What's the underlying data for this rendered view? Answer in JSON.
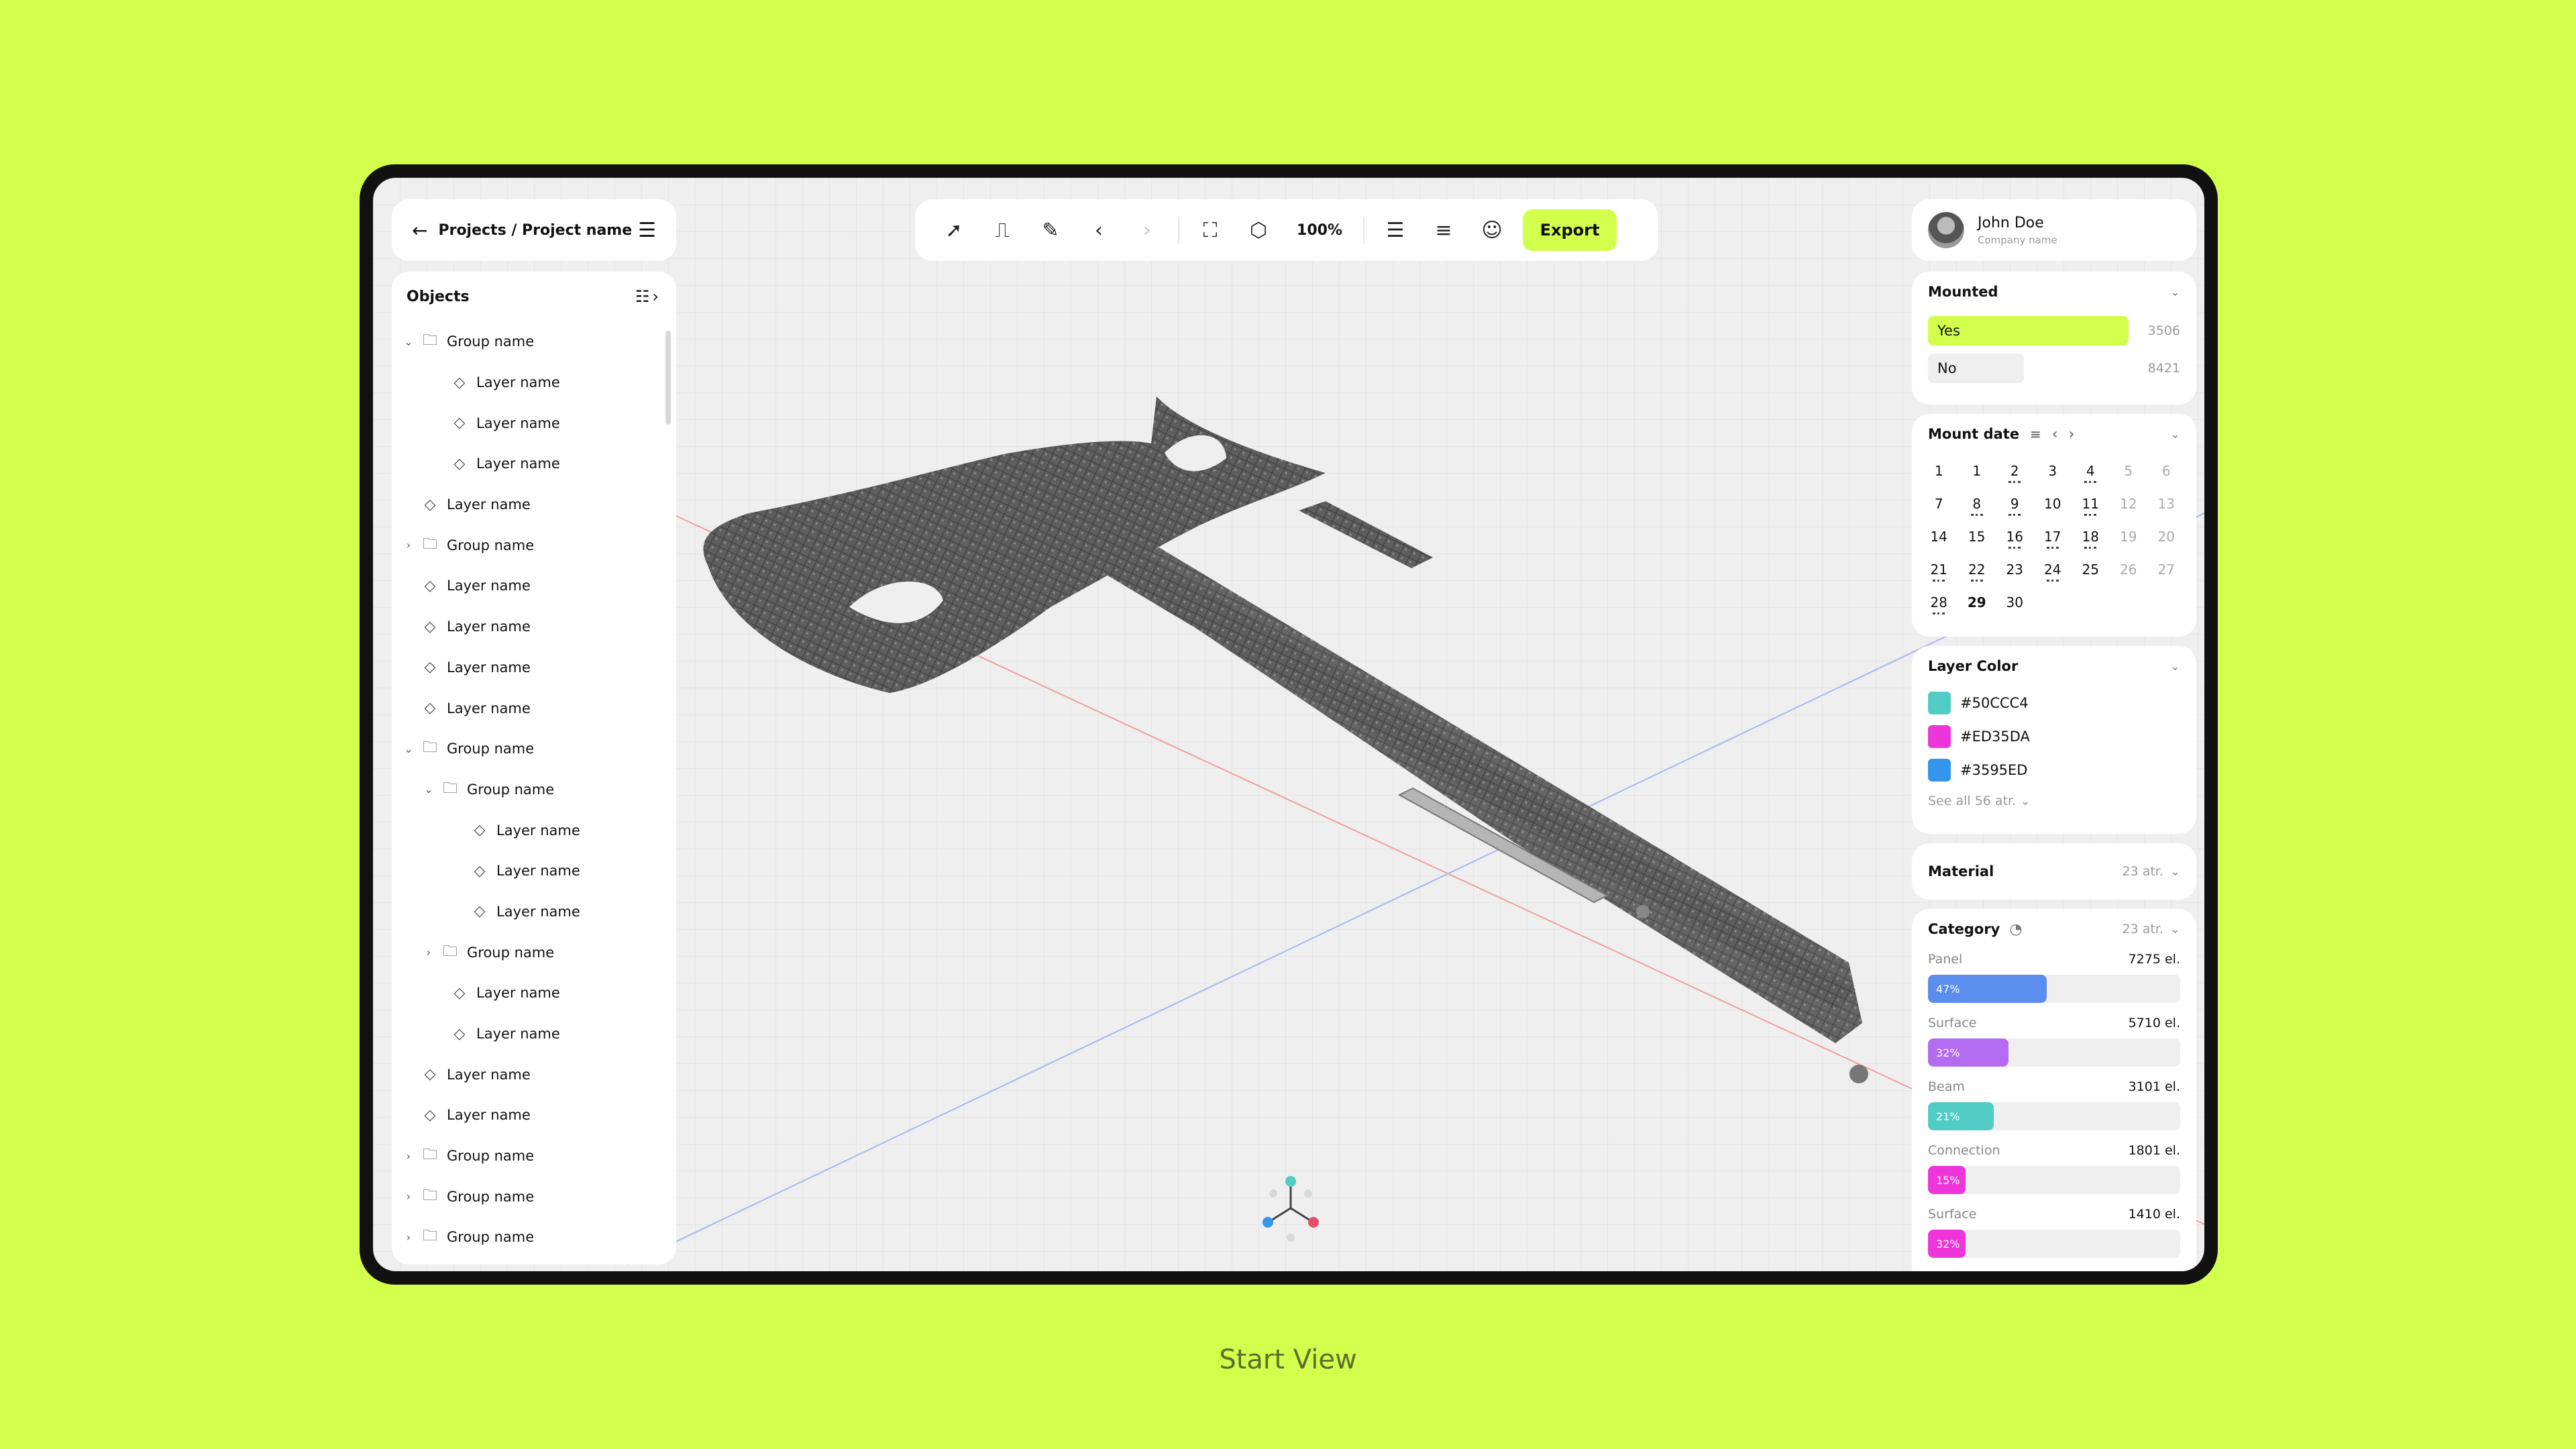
{
  "breadcrumb": {
    "title": "Projects / Project name"
  },
  "objects": {
    "title": "Objects",
    "items": [
      {
        "label": "Group name",
        "type": "group",
        "level": 0,
        "expanded": true
      },
      {
        "label": "Layer name",
        "type": "layer",
        "level": 1
      },
      {
        "label": "Layer name",
        "type": "layer",
        "level": 1
      },
      {
        "label": "Layer name",
        "type": "layer",
        "level": 1
      },
      {
        "label": "Layer name",
        "type": "layer",
        "level": 0
      },
      {
        "label": "Group name",
        "type": "group",
        "level": 0,
        "expanded": false
      },
      {
        "label": "Layer name",
        "type": "layer",
        "level": 0
      },
      {
        "label": "Layer name",
        "type": "layer",
        "level": 0
      },
      {
        "label": "Layer name",
        "type": "layer",
        "level": 0
      },
      {
        "label": "Layer name",
        "type": "layer",
        "level": 0
      },
      {
        "label": "Group name",
        "type": "group",
        "level": 0,
        "expanded": true
      },
      {
        "label": "Group name",
        "type": "group",
        "level": 1,
        "expanded": true
      },
      {
        "label": "Layer name",
        "type": "layer",
        "level": 2
      },
      {
        "label": "Layer name",
        "type": "layer",
        "level": 2
      },
      {
        "label": "Layer name",
        "type": "layer",
        "level": 2
      },
      {
        "label": "Group name",
        "type": "group",
        "level": 1,
        "expanded": false
      },
      {
        "label": "Layer name",
        "type": "layer",
        "level": 1
      },
      {
        "label": "Layer name",
        "type": "layer",
        "level": 1
      },
      {
        "label": "Layer name",
        "type": "layer",
        "level": 0
      },
      {
        "label": "Layer name",
        "type": "layer",
        "level": 0
      },
      {
        "label": "Group name",
        "type": "group",
        "level": 0,
        "expanded": false
      },
      {
        "label": "Group name",
        "type": "group",
        "level": 0,
        "expanded": false
      },
      {
        "label": "Group name",
        "type": "group",
        "level": 0,
        "expanded": false
      }
    ]
  },
  "toolbar": {
    "zoom": "100%",
    "export_label": "Export",
    "icons": [
      "cursor-icon",
      "paint-roller-icon",
      "ruler-icon",
      "undo-icon",
      "redo-icon",
      "crop-icon",
      "cube-icon",
      "list-icon",
      "menu-icon",
      "user-icon"
    ]
  },
  "user": {
    "name": "John Doe",
    "company": "Company name"
  },
  "mounted": {
    "title": "Mounted",
    "options": [
      {
        "label": "Yes",
        "count": "3506",
        "color": "#D2FF4C",
        "fraction": 0.88
      },
      {
        "label": "No",
        "count": "8421",
        "color": "#EFEFEF",
        "fraction": 0.42
      }
    ]
  },
  "mount_date": {
    "title": "Mount date",
    "days": [
      {
        "d": "1"
      },
      {
        "d": "1"
      },
      {
        "d": "2",
        "dot": true
      },
      {
        "d": "3"
      },
      {
        "d": "4",
        "dot": true
      },
      {
        "d": "5",
        "mute": true
      },
      {
        "d": "6",
        "mute": true
      },
      {
        "d": "7"
      },
      {
        "d": "8",
        "dot": true
      },
      {
        "d": "9",
        "dot": true
      },
      {
        "d": "10"
      },
      {
        "d": "11",
        "dot": true
      },
      {
        "d": "12",
        "mute": true
      },
      {
        "d": "13",
        "mute": true
      },
      {
        "d": "14"
      },
      {
        "d": "15"
      },
      {
        "d": "16",
        "dot": true
      },
      {
        "d": "17",
        "dot": true
      },
      {
        "d": "18",
        "dot": true
      },
      {
        "d": "19",
        "mute": true
      },
      {
        "d": "20",
        "mute": true
      },
      {
        "d": "21",
        "dot": true
      },
      {
        "d": "22",
        "dot": true
      },
      {
        "d": "23"
      },
      {
        "d": "24",
        "dot": true
      },
      {
        "d": "25"
      },
      {
        "d": "26",
        "mute": true
      },
      {
        "d": "27",
        "mute": true
      },
      {
        "d": "28",
        "dot": true
      },
      {
        "d": "29",
        "bold": true
      },
      {
        "d": "30"
      }
    ]
  },
  "layer_color": {
    "title": "Layer Color",
    "colors": [
      {
        "hex": "#50CCC4",
        "label": "#50CCC4"
      },
      {
        "hex": "#ED35DA",
        "label": "#ED35DA"
      },
      {
        "hex": "#3595ED",
        "label": "#3595ED"
      }
    ],
    "see_all": "See all 56 atr."
  },
  "material": {
    "title": "Material",
    "count": "23 atr."
  },
  "category": {
    "title": "Category",
    "count": "23 atr.",
    "items": [
      {
        "name": "Panel",
        "count": "7275 el.",
        "pct": "47%",
        "value": 0.47,
        "color": "#5B8DEF"
      },
      {
        "name": "Surface",
        "count": "5710 el.",
        "pct": "32%",
        "value": 0.32,
        "color": "#B36CF0"
      },
      {
        "name": "Beam",
        "count": "3101 el.",
        "pct": "21%",
        "value": 0.26,
        "color": "#50CCC4"
      },
      {
        "name": "Connection",
        "count": "1801 el.",
        "pct": "15%",
        "value": 0.15,
        "color": "#ED35DA"
      },
      {
        "name": "Surface",
        "count": "1410 el.",
        "pct": "32%",
        "value": 0.15,
        "color": "#ED35DA"
      }
    ]
  },
  "caption": "Start View"
}
